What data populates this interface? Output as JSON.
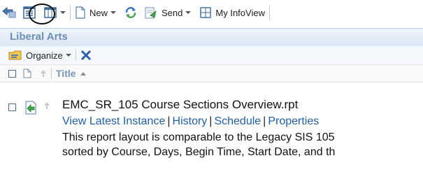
{
  "toolbar": {
    "new_label": "New",
    "send_label": "Send",
    "my_infoview_label": "My InfoView"
  },
  "section": {
    "title": "Liberal Arts"
  },
  "subbar": {
    "organize_label": "Organize"
  },
  "columns": {
    "title_label": "Title"
  },
  "row": {
    "title": "EMC_SR_105 Course Sections Overview.rpt",
    "links": {
      "view_latest": "View Latest Instance",
      "history": "History",
      "schedule": "Schedule",
      "properties": "Properties"
    },
    "description_line1": "This report layout is comparable to the Legacy SIS 105",
    "description_line2": "sorted by Course, Days, Begin Time, Start Date, and th"
  },
  "colors": {
    "link": "#2160a8",
    "header_text": "#6d8fb5",
    "column_text": "#7a96b6"
  }
}
